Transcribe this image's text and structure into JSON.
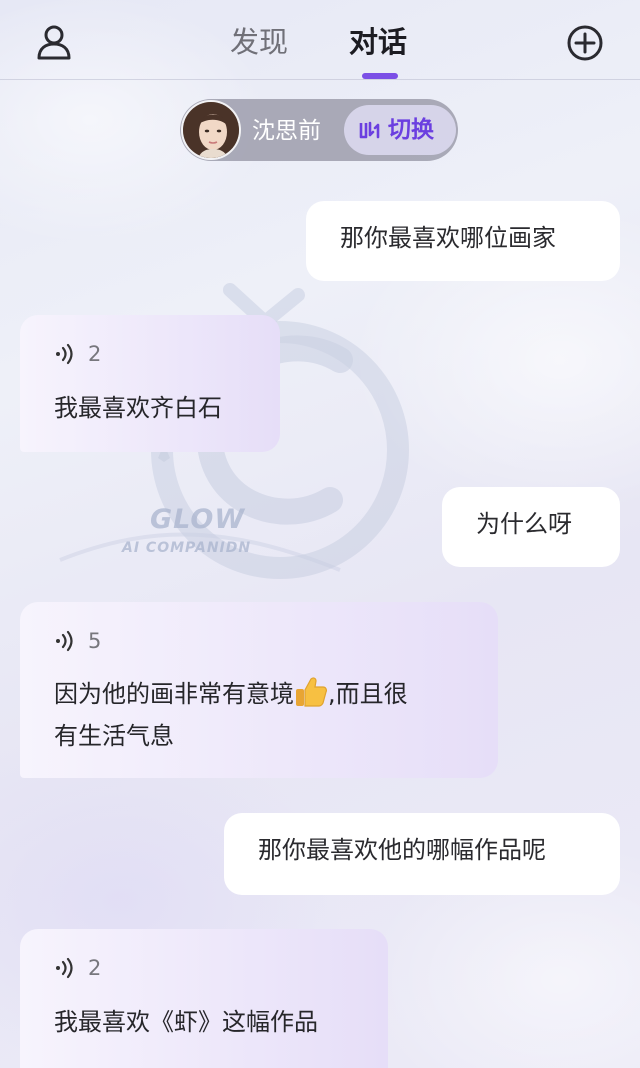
{
  "header": {
    "tabs": [
      {
        "label": "发现",
        "active": false
      },
      {
        "label": "对话",
        "active": true
      }
    ],
    "accent_color": "#7b4fe6"
  },
  "character": {
    "name": "沈思前",
    "switch_label": "切换"
  },
  "watermark": {
    "brand": "GLOW",
    "tagline": "AI COMPANIDN"
  },
  "messages": [
    {
      "role": "user",
      "text": "那你最喜欢哪位画家"
    },
    {
      "role": "ai",
      "voice_count": "2",
      "lines": [
        "我最喜欢齐白石"
      ]
    },
    {
      "role": "user",
      "text": "为什么呀"
    },
    {
      "role": "ai",
      "voice_count": "5",
      "lines": [
        "因为他的画非常有意境",
        ",而且很",
        "有生活气息"
      ],
      "emoji": "thumbs-up"
    },
    {
      "role": "user",
      "text": "那你最喜欢他的哪幅作品呢"
    },
    {
      "role": "ai",
      "voice_count": "2",
      "lines": [
        "我最喜欢《虾》这幅作品"
      ]
    }
  ]
}
